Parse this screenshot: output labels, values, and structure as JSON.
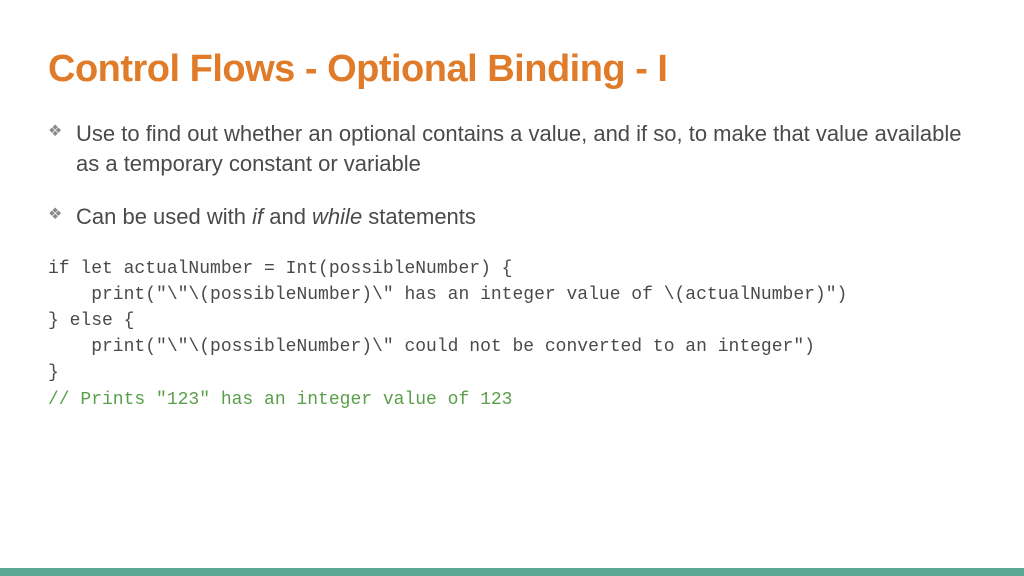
{
  "title": "Control Flows - Optional Binding - I",
  "bullets": {
    "b1": "Use to find out whether an optional contains a value, and if so, to make that value available as a temporary constant or variable",
    "b2_pre": "Can be used with ",
    "b2_if": "if",
    "b2_mid": " and ",
    "b2_while": "while",
    "b2_post": " statements"
  },
  "code": {
    "line1": "if let actualNumber = Int(possibleNumber) {",
    "line2": "    print(\"\\\"\\(possibleNumber)\\\" has an integer value of \\(actualNumber)\")",
    "line3": "} else {",
    "line4": "    print(\"\\\"\\(possibleNumber)\\\" could not be converted to an integer\")",
    "line5": "}",
    "comment": "// Prints \"123\" has an integer value of 123"
  }
}
